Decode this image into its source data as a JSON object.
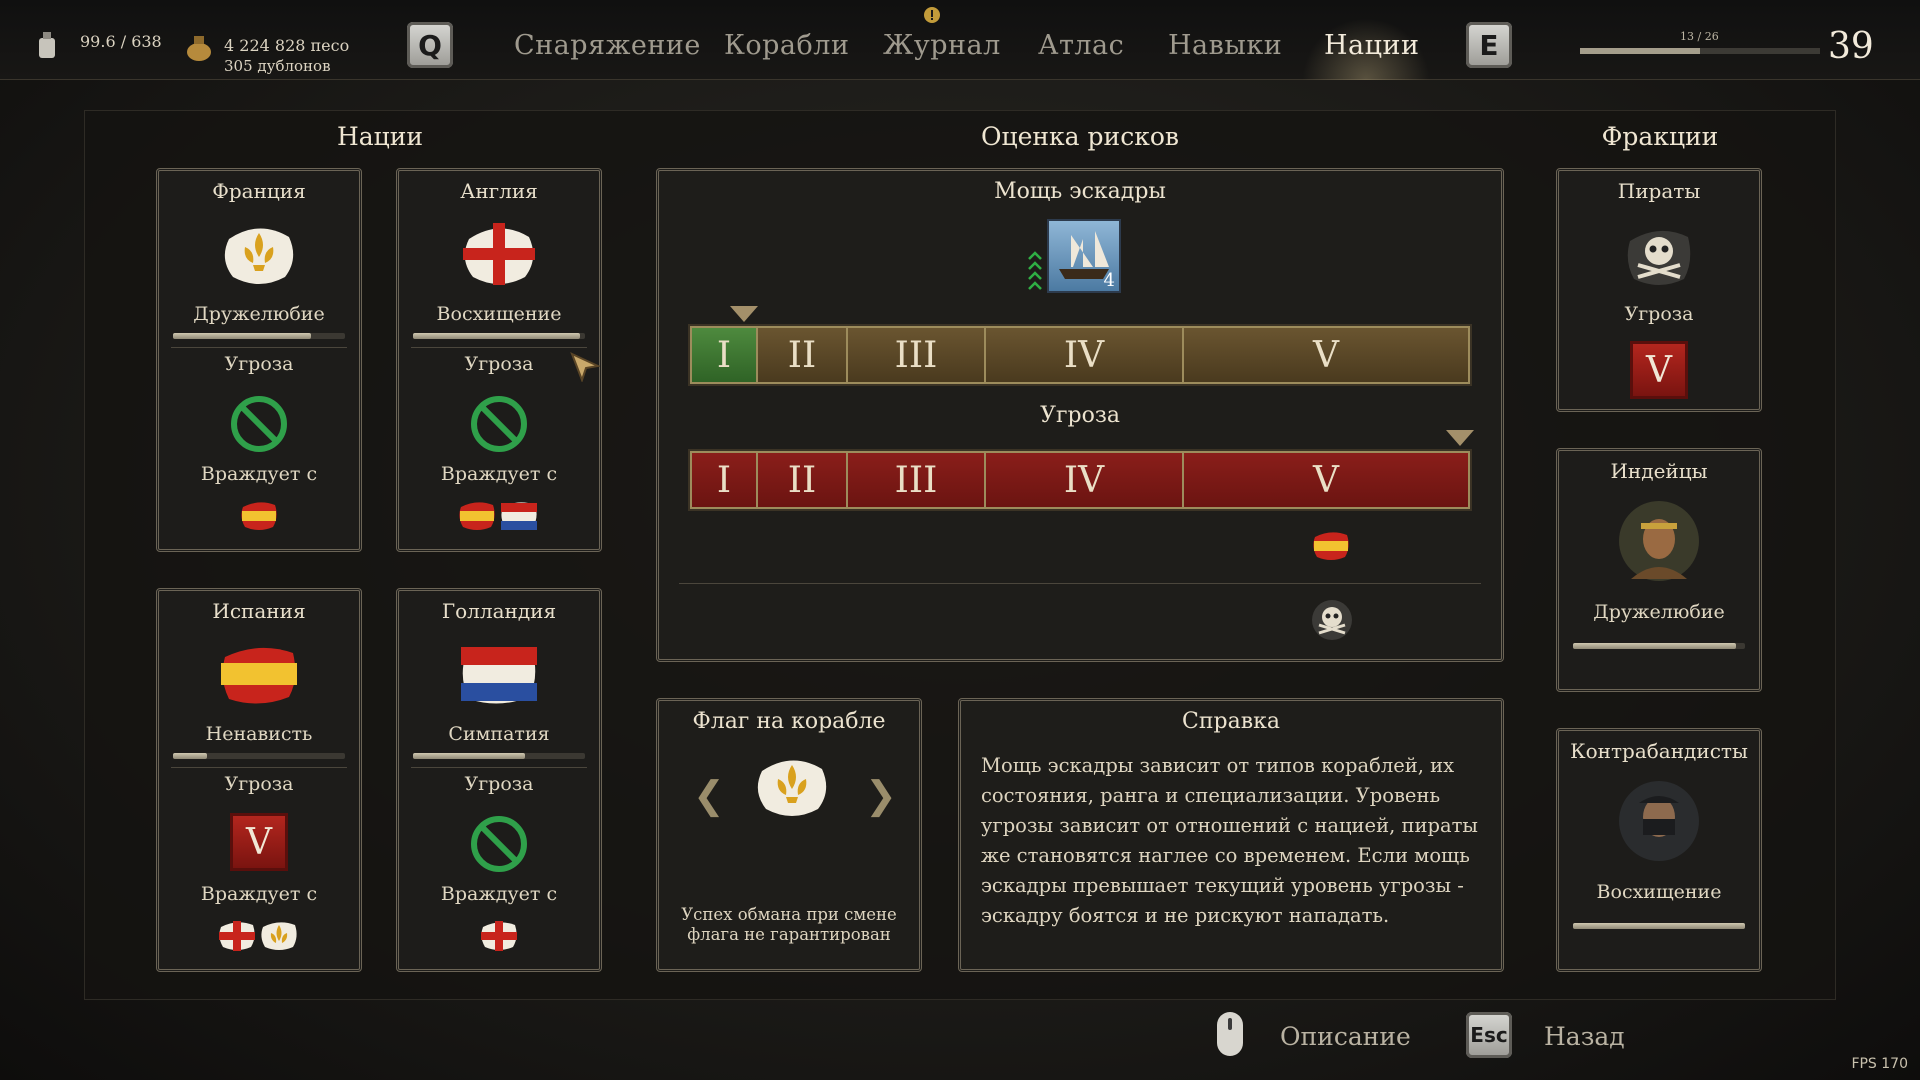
{
  "header": {
    "weight": "99.6 / 638",
    "money": "4 224 828 песо",
    "doubloons": "305 дублонов",
    "key_left": "Q",
    "key_right": "E",
    "tabs": [
      "Снаряжение",
      "Корабли",
      "Журнал",
      "Атлас",
      "Навыки",
      "Нации"
    ],
    "active_tab": "Нации",
    "xp_text": "13 / 26",
    "xp_progress": 0.5,
    "level": "39"
  },
  "nations": {
    "title": "Нации",
    "threat_label": "Угроза",
    "hostile_label": "Враждует с",
    "cards": [
      {
        "name": "Франция",
        "relation": "Дружелюбие",
        "relation_level": 0.8,
        "threat": "none",
        "hostile": [
          "spain-flag"
        ]
      },
      {
        "name": "Англия",
        "relation": "Восхищение",
        "relation_level": 0.97,
        "threat": "none",
        "hostile": [
          "spain-flag",
          "holland-flag"
        ]
      },
      {
        "name": "Испания",
        "relation": "Ненависть",
        "relation_level": 0.2,
        "threat": "V",
        "hostile": [
          "england-flag",
          "france-flag"
        ]
      },
      {
        "name": "Голландия",
        "relation": "Симпатия",
        "relation_level": 0.65,
        "threat": "none",
        "hostile": [
          "england-flag"
        ]
      }
    ]
  },
  "risk": {
    "title": "Оценка рисков",
    "squadron_title": "Мощь эскадры",
    "ship_count": "4",
    "power_levels": [
      "I",
      "II",
      "III",
      "IV",
      "V"
    ],
    "power_current": "I",
    "threat_title": "Угроза",
    "threat_levels": [
      "I",
      "II",
      "III",
      "IV",
      "V"
    ],
    "threat_current": "V"
  },
  "flag": {
    "title": "Флаг на корабле",
    "note": "Успех обмана при смене флага не гарантирован"
  },
  "help": {
    "title": "Справка",
    "text": "Мощь эскадры зависит от типов кораблей, их состояния, ранга и специализации. Уровень угрозы зависит от отношений с нацией, пираты же становятся наглее со временем. Если мощь эскадры превышает текущий уровень угрозы - эскадру боятся и не рискуют нападать."
  },
  "factions": {
    "title": "Фракции",
    "pirates": {
      "name": "Пираты",
      "label": "Угроза",
      "threat": "V"
    },
    "indians": {
      "name": "Индейцы",
      "relation": "Дружелюбие",
      "relation_level": 0.95
    },
    "smugglers": {
      "name": "Контрабандисты",
      "relation": "Восхищение",
      "relation_level": 1.0
    }
  },
  "footer": {
    "describe": "Описание",
    "esc_key": "Esc",
    "back": "Назад",
    "fps": "FPS 170"
  },
  "colors": {
    "threat_red": "#8a1e1a",
    "power_green": "#3c7a30",
    "gold": "#9d8c5c"
  }
}
